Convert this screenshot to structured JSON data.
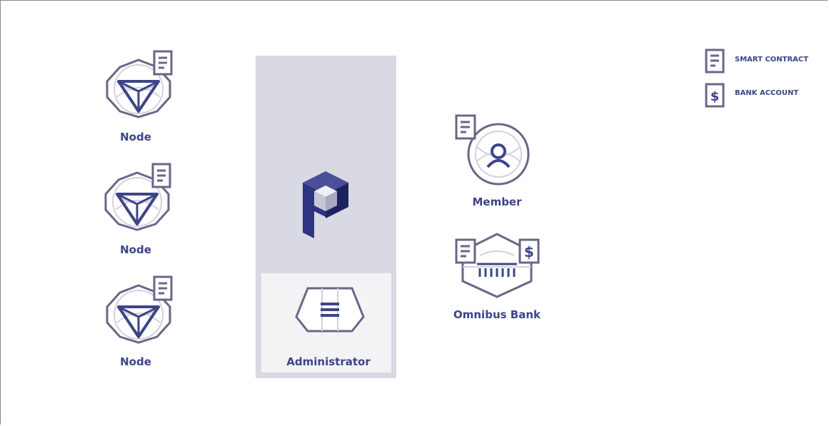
{
  "nodes": [
    {
      "label": "Node"
    },
    {
      "label": "Node"
    },
    {
      "label": "Node"
    }
  ],
  "administrator": {
    "label": "Administrator"
  },
  "member": {
    "label": "Member"
  },
  "omnibus_bank": {
    "label": "Omnibus Bank"
  },
  "legend": {
    "smart_contract": "SMART CONTRACT",
    "bank_account": "BANK ACCOUNT"
  },
  "colors": {
    "outline": "#6b6688",
    "accent": "#3d4487",
    "ring": "#c8c8d6",
    "panel": "#d9d9e4"
  }
}
